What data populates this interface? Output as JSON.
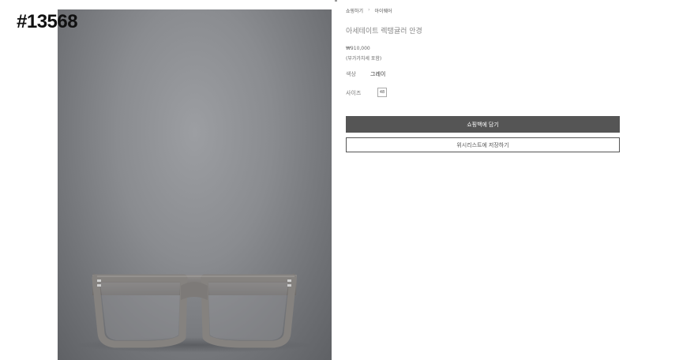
{
  "watermark": {
    "id_text": "#13568"
  },
  "breadcrumb": {
    "items": [
      "쇼핑하기",
      "아이웨어"
    ],
    "separator": "›"
  },
  "product": {
    "title": "아세테이트 렉탱귤러 안경",
    "price": "₩910,000",
    "vat_note": "(부가가치세 포함)",
    "color_label": "색상",
    "color_value": "그레이",
    "size_label": "사이즈",
    "size_options": [
      "48"
    ]
  },
  "actions": {
    "add_to_cart": "쇼핑백에 담기",
    "save_to_wishlist": "위시리스트에 저장하기"
  },
  "colors": {
    "cart_button_bg": "#555555",
    "background": "#ffffff"
  },
  "image": {
    "subject": "eyeglasses-icon"
  }
}
